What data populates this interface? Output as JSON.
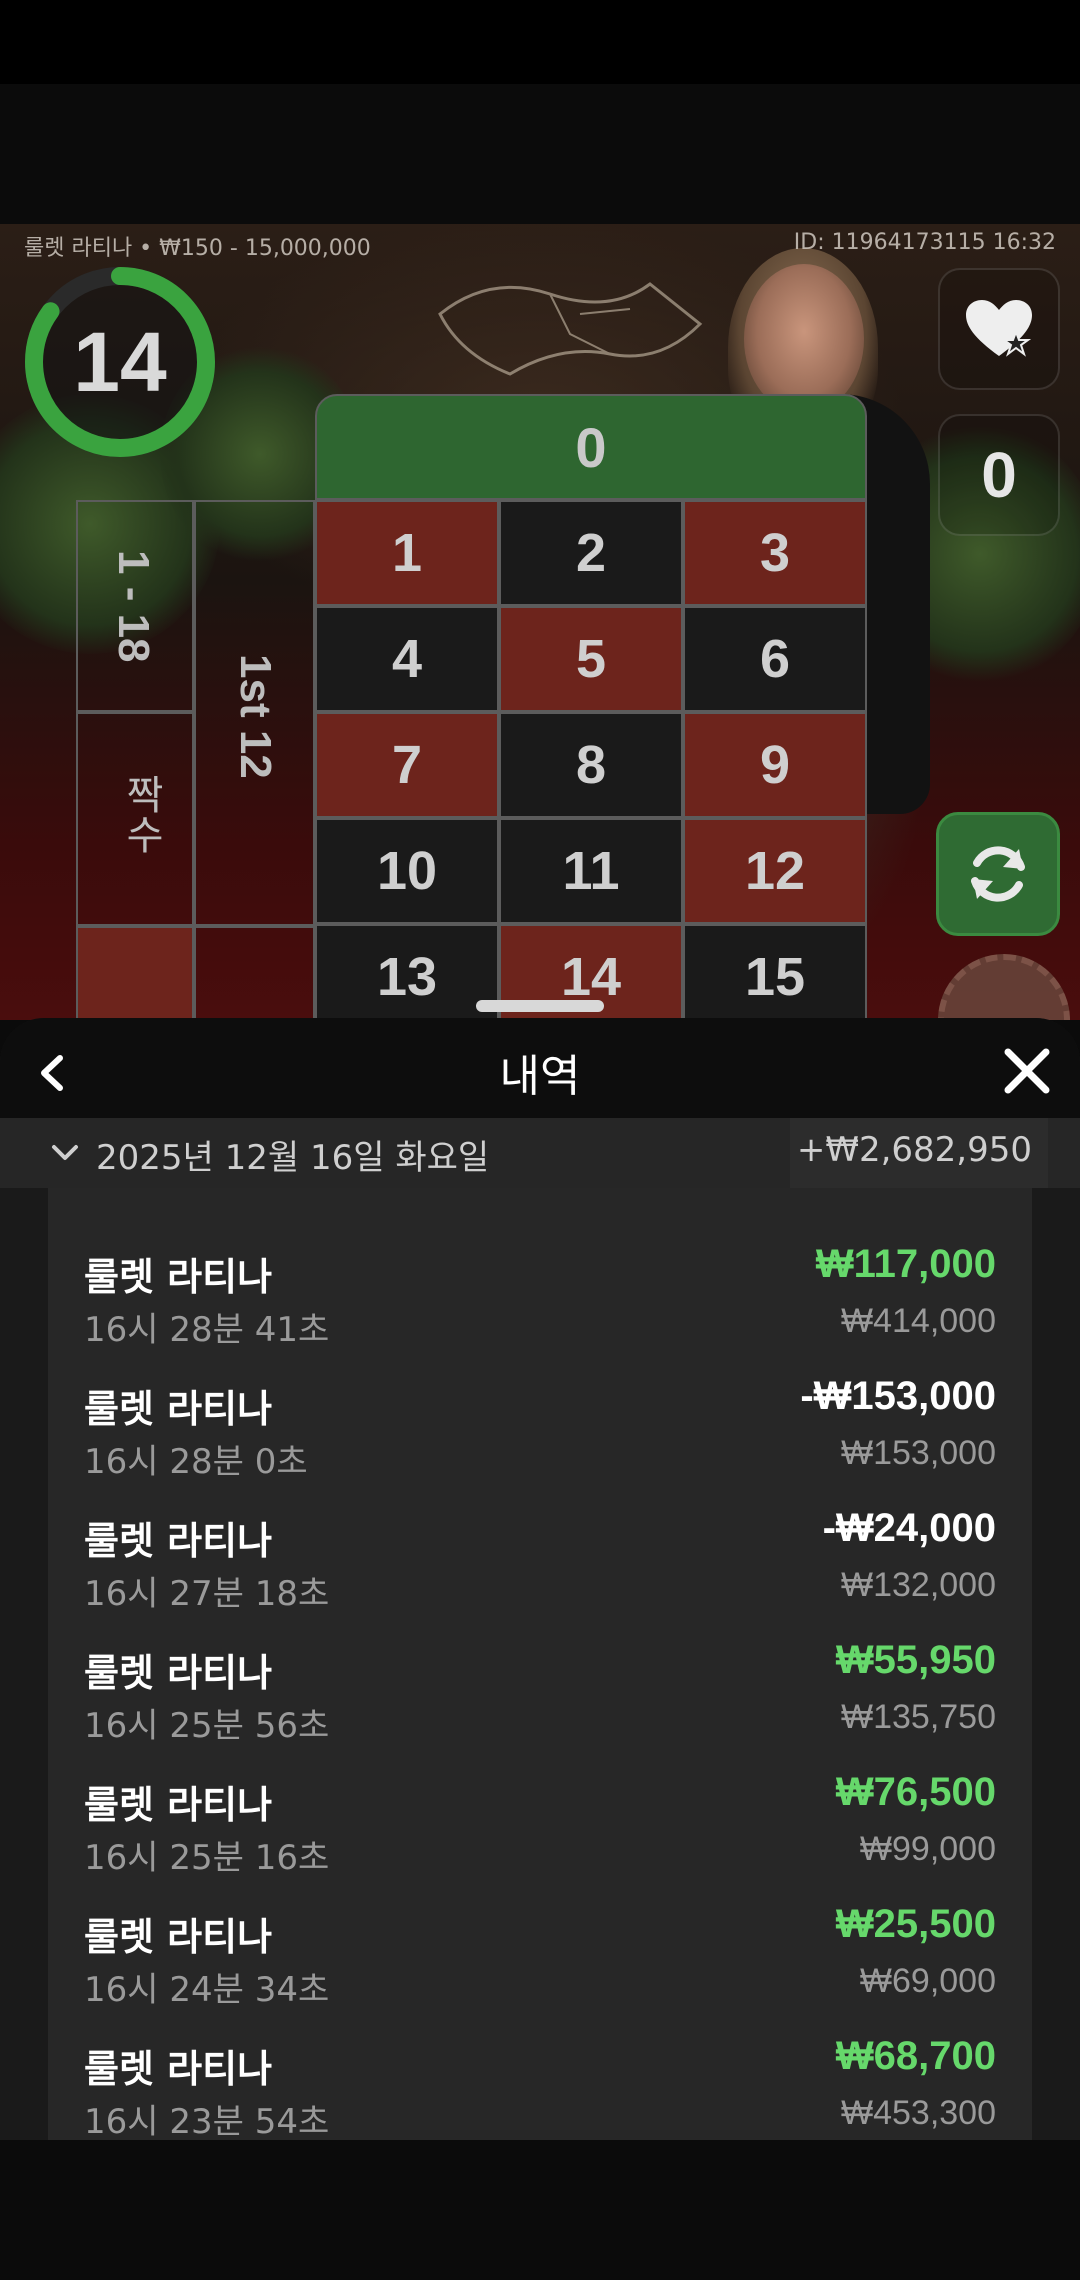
{
  "game": {
    "table_info": "룰렛 라티나 • ₩150 - 15,000,000",
    "round_info": "ID: 11964173115  16:32",
    "timer": {
      "value": "14",
      "progress": 0.85,
      "color": "#3aa33f"
    },
    "zero_button_label": "0",
    "table": {
      "zero": "0",
      "rows": [
        [
          {
            "n": "1",
            "c": "red"
          },
          {
            "n": "2",
            "c": "black"
          },
          {
            "n": "3",
            "c": "red"
          }
        ],
        [
          {
            "n": "4",
            "c": "black"
          },
          {
            "n": "5",
            "c": "red"
          },
          {
            "n": "6",
            "c": "black"
          }
        ],
        [
          {
            "n": "7",
            "c": "red"
          },
          {
            "n": "8",
            "c": "black"
          },
          {
            "n": "9",
            "c": "red"
          }
        ],
        [
          {
            "n": "10",
            "c": "black"
          },
          {
            "n": "11",
            "c": "black"
          },
          {
            "n": "12",
            "c": "red"
          }
        ],
        [
          {
            "n": "13",
            "c": "black"
          },
          {
            "n": "14",
            "c": "red"
          },
          {
            "n": "15",
            "c": "black"
          }
        ]
      ],
      "outside_low": "1 - 18",
      "outside_dozen": "1st 12",
      "outside_even": "짝수"
    },
    "icons": [
      "heart-star-icon",
      "refresh-icon"
    ]
  },
  "history": {
    "title": "내역",
    "date_label": "2025년 12월 16일 화요일",
    "date_total": "+₩2,682,950",
    "items": [
      {
        "name": "룰렛 라티나",
        "time": "16시 28분 41초",
        "amount": "₩117,000",
        "result": "win",
        "bet": "₩414,000"
      },
      {
        "name": "룰렛 라티나",
        "time": "16시 28분 0초",
        "amount": "-₩153,000",
        "result": "loss",
        "bet": "₩153,000"
      },
      {
        "name": "룰렛 라티나",
        "time": "16시 27분 18초",
        "amount": "-₩24,000",
        "result": "loss",
        "bet": "₩132,000"
      },
      {
        "name": "룰렛 라티나",
        "time": "16시 25분 56초",
        "amount": "₩55,950",
        "result": "win",
        "bet": "₩135,750"
      },
      {
        "name": "룰렛 라티나",
        "time": "16시 25분 16초",
        "amount": "₩76,500",
        "result": "win",
        "bet": "₩99,000"
      },
      {
        "name": "룰렛 라티나",
        "time": "16시 24분 34초",
        "amount": "₩25,500",
        "result": "win",
        "bet": "₩69,000"
      },
      {
        "name": "룰렛 라티나",
        "time": "16시 23분 54초",
        "amount": "₩68,700",
        "result": "win",
        "bet": "₩453,300"
      }
    ]
  },
  "colors": {
    "win": "#66d86b",
    "loss": "#ffffff",
    "red_cell": "#6d241c",
    "green_zero": "#2e6630"
  }
}
